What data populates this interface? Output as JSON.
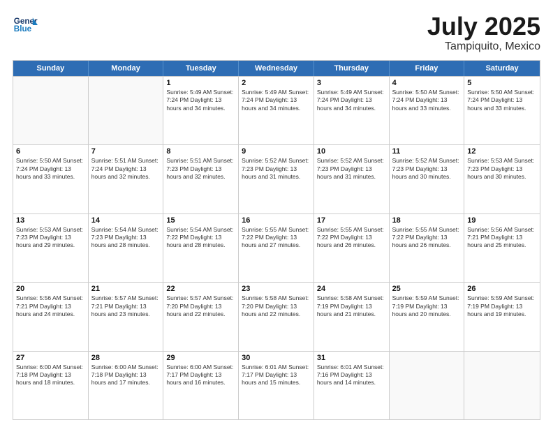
{
  "header": {
    "logo_line1": "General",
    "logo_line2": "Blue",
    "month": "July 2025",
    "location": "Tampiquito, Mexico"
  },
  "day_headers": [
    "Sunday",
    "Monday",
    "Tuesday",
    "Wednesday",
    "Thursday",
    "Friday",
    "Saturday"
  ],
  "weeks": [
    [
      {
        "day": "",
        "info": ""
      },
      {
        "day": "",
        "info": ""
      },
      {
        "day": "1",
        "info": "Sunrise: 5:49 AM\nSunset: 7:24 PM\nDaylight: 13 hours\nand 34 minutes."
      },
      {
        "day": "2",
        "info": "Sunrise: 5:49 AM\nSunset: 7:24 PM\nDaylight: 13 hours\nand 34 minutes."
      },
      {
        "day": "3",
        "info": "Sunrise: 5:49 AM\nSunset: 7:24 PM\nDaylight: 13 hours\nand 34 minutes."
      },
      {
        "day": "4",
        "info": "Sunrise: 5:50 AM\nSunset: 7:24 PM\nDaylight: 13 hours\nand 33 minutes."
      },
      {
        "day": "5",
        "info": "Sunrise: 5:50 AM\nSunset: 7:24 PM\nDaylight: 13 hours\nand 33 minutes."
      }
    ],
    [
      {
        "day": "6",
        "info": "Sunrise: 5:50 AM\nSunset: 7:24 PM\nDaylight: 13 hours\nand 33 minutes."
      },
      {
        "day": "7",
        "info": "Sunrise: 5:51 AM\nSunset: 7:24 PM\nDaylight: 13 hours\nand 32 minutes."
      },
      {
        "day": "8",
        "info": "Sunrise: 5:51 AM\nSunset: 7:23 PM\nDaylight: 13 hours\nand 32 minutes."
      },
      {
        "day": "9",
        "info": "Sunrise: 5:52 AM\nSunset: 7:23 PM\nDaylight: 13 hours\nand 31 minutes."
      },
      {
        "day": "10",
        "info": "Sunrise: 5:52 AM\nSunset: 7:23 PM\nDaylight: 13 hours\nand 31 minutes."
      },
      {
        "day": "11",
        "info": "Sunrise: 5:52 AM\nSunset: 7:23 PM\nDaylight: 13 hours\nand 30 minutes."
      },
      {
        "day": "12",
        "info": "Sunrise: 5:53 AM\nSunset: 7:23 PM\nDaylight: 13 hours\nand 30 minutes."
      }
    ],
    [
      {
        "day": "13",
        "info": "Sunrise: 5:53 AM\nSunset: 7:23 PM\nDaylight: 13 hours\nand 29 minutes."
      },
      {
        "day": "14",
        "info": "Sunrise: 5:54 AM\nSunset: 7:23 PM\nDaylight: 13 hours\nand 28 minutes."
      },
      {
        "day": "15",
        "info": "Sunrise: 5:54 AM\nSunset: 7:22 PM\nDaylight: 13 hours\nand 28 minutes."
      },
      {
        "day": "16",
        "info": "Sunrise: 5:55 AM\nSunset: 7:22 PM\nDaylight: 13 hours\nand 27 minutes."
      },
      {
        "day": "17",
        "info": "Sunrise: 5:55 AM\nSunset: 7:22 PM\nDaylight: 13 hours\nand 26 minutes."
      },
      {
        "day": "18",
        "info": "Sunrise: 5:55 AM\nSunset: 7:22 PM\nDaylight: 13 hours\nand 26 minutes."
      },
      {
        "day": "19",
        "info": "Sunrise: 5:56 AM\nSunset: 7:21 PM\nDaylight: 13 hours\nand 25 minutes."
      }
    ],
    [
      {
        "day": "20",
        "info": "Sunrise: 5:56 AM\nSunset: 7:21 PM\nDaylight: 13 hours\nand 24 minutes."
      },
      {
        "day": "21",
        "info": "Sunrise: 5:57 AM\nSunset: 7:21 PM\nDaylight: 13 hours\nand 23 minutes."
      },
      {
        "day": "22",
        "info": "Sunrise: 5:57 AM\nSunset: 7:20 PM\nDaylight: 13 hours\nand 22 minutes."
      },
      {
        "day": "23",
        "info": "Sunrise: 5:58 AM\nSunset: 7:20 PM\nDaylight: 13 hours\nand 22 minutes."
      },
      {
        "day": "24",
        "info": "Sunrise: 5:58 AM\nSunset: 7:19 PM\nDaylight: 13 hours\nand 21 minutes."
      },
      {
        "day": "25",
        "info": "Sunrise: 5:59 AM\nSunset: 7:19 PM\nDaylight: 13 hours\nand 20 minutes."
      },
      {
        "day": "26",
        "info": "Sunrise: 5:59 AM\nSunset: 7:19 PM\nDaylight: 13 hours\nand 19 minutes."
      }
    ],
    [
      {
        "day": "27",
        "info": "Sunrise: 6:00 AM\nSunset: 7:18 PM\nDaylight: 13 hours\nand 18 minutes."
      },
      {
        "day": "28",
        "info": "Sunrise: 6:00 AM\nSunset: 7:18 PM\nDaylight: 13 hours\nand 17 minutes."
      },
      {
        "day": "29",
        "info": "Sunrise: 6:00 AM\nSunset: 7:17 PM\nDaylight: 13 hours\nand 16 minutes."
      },
      {
        "day": "30",
        "info": "Sunrise: 6:01 AM\nSunset: 7:17 PM\nDaylight: 13 hours\nand 15 minutes."
      },
      {
        "day": "31",
        "info": "Sunrise: 6:01 AM\nSunset: 7:16 PM\nDaylight: 13 hours\nand 14 minutes."
      },
      {
        "day": "",
        "info": ""
      },
      {
        "day": "",
        "info": ""
      }
    ]
  ]
}
